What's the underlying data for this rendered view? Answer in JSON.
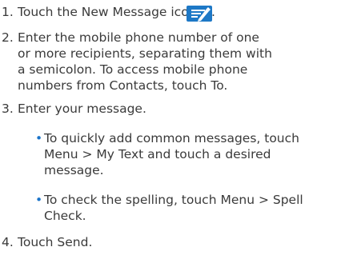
{
  "accent_color": "#1a73c9",
  "steps": [
    {
      "number": "1.",
      "text": "Touch the New Message icon",
      "suffix": ".",
      "icon": "new-message-icon"
    },
    {
      "number": "2.",
      "text": "Enter the mobile phone number of one\nor more recipients, separating them with\na semicolon. To access mobile phone\nnumbers from Contacts, touch To."
    },
    {
      "number": "3.",
      "text": "Enter your message."
    },
    {
      "number": "4.",
      "text": "Touch Send."
    }
  ],
  "bullets": [
    {
      "marker": "•",
      "text": "To quickly add common messages, touch\nMenu > My Text and touch a desired\nmessage."
    },
    {
      "marker": "•",
      "text": "To check the spelling, touch Menu > Spell\nCheck."
    }
  ]
}
